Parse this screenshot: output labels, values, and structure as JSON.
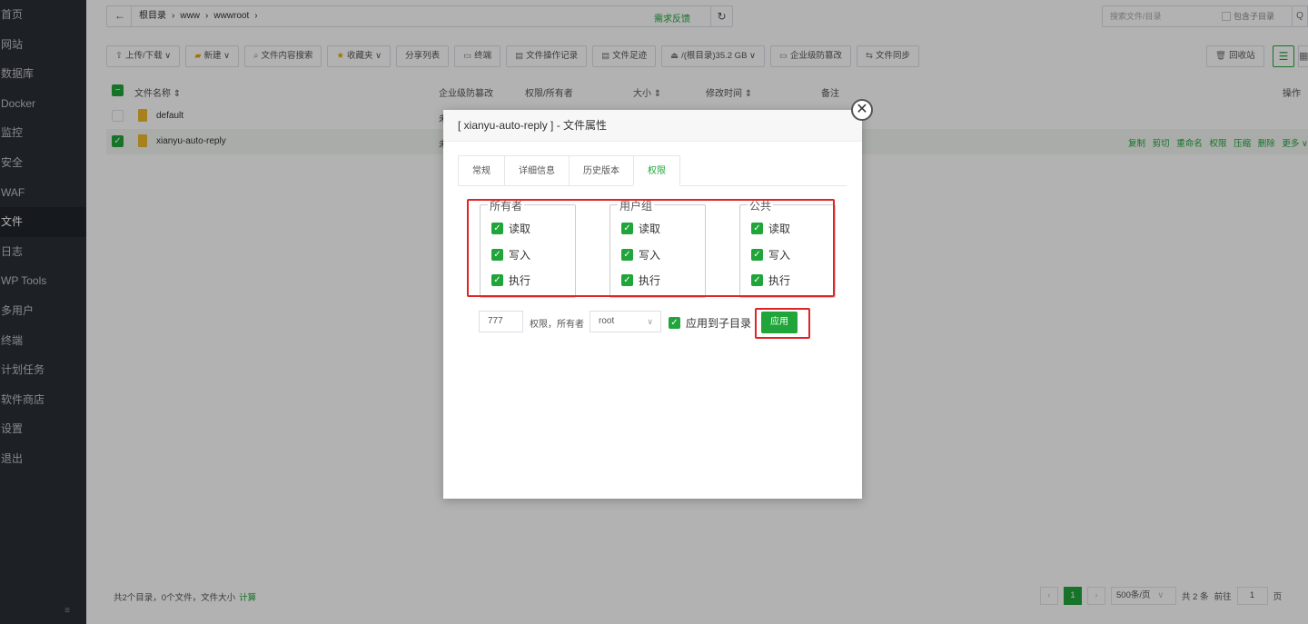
{
  "sidebar": {
    "items": [
      "首页",
      "网站",
      "数据库",
      "Docker",
      "监控",
      "安全",
      "WAF",
      "文件",
      "日志",
      "WP Tools",
      "多用户",
      "终端",
      "计划任务",
      "软件商店",
      "设置",
      "退出"
    ],
    "active_index": 7,
    "footer": "≡"
  },
  "pathbar": {
    "back": "←",
    "crumbs": [
      "根目录",
      "›",
      "www",
      "›",
      "wwwroot",
      "›"
    ],
    "refresh": "↻"
  },
  "feedback": "需求反馈",
  "search": {
    "placeholder": "搜索文件/目录",
    "include_sub": "包含子目录",
    "button": "Q"
  },
  "toolbar": [
    {
      "icon": "⇧",
      "label": "上传/下载 ∨"
    },
    {
      "icon": "▰",
      "label": "新建 ∨",
      "yellow": true
    },
    {
      "icon": "⌕",
      "label": "文件内容搜索"
    },
    {
      "icon": "★",
      "label": "收藏夹 ∨",
      "yellow": true
    },
    {
      "icon": "",
      "label": "分享列表"
    },
    {
      "icon": "▭",
      "label": "终端"
    },
    {
      "icon": "▤",
      "label": "文件操作记录"
    },
    {
      "icon": "▤",
      "label": "文件足迹"
    },
    {
      "icon": "⏏",
      "label": "/(根目录)35.2 GB ∨"
    },
    {
      "icon": "▭",
      "label": "企业级防篡改"
    },
    {
      "icon": "⇆",
      "label": "文件同步"
    }
  ],
  "recycle": "回收站",
  "view_list_icon": "☰",
  "view_grid_icon": "▦",
  "table": {
    "headers": {
      "name": "文件名称 ⇕",
      "tamper": "企业级防篡改",
      "perm": "权限/所有者",
      "size": "大小 ⇕",
      "mtime": "修改时间 ⇕",
      "note": "备注",
      "ops": "操作"
    },
    "rows": [
      {
        "name": "default",
        "tamper": "未",
        "selected": false
      },
      {
        "name": "xianyu-auto-reply",
        "tamper": "未",
        "selected": true
      }
    ],
    "row_ops": [
      "复制",
      "剪切",
      "重命名",
      "权限",
      "压缩",
      "删除",
      "更多 ∨"
    ]
  },
  "footer": {
    "summary": "共2个目录，0个文件，文件大小",
    "calc": "计算"
  },
  "pager": {
    "prev": "‹",
    "current": "1",
    "next": "›",
    "page_size": "500条/页",
    "arrow": "∨",
    "total": "共 2 条",
    "goto": "前往",
    "page_input": "1",
    "page_suffix": "页"
  },
  "dialog": {
    "title": "[ xianyu-auto-reply ] - 文件属性",
    "close": "✕",
    "tabs": [
      "常规",
      "详细信息",
      "历史版本",
      "权限"
    ],
    "active_tab": 3,
    "groups": [
      {
        "legend": "所有者",
        "items": [
          "读取",
          "写入",
          "执行"
        ]
      },
      {
        "legend": "用户组",
        "items": [
          "读取",
          "写入",
          "执行"
        ]
      },
      {
        "legend": "公共",
        "items": [
          "读取",
          "写入",
          "执行"
        ]
      }
    ],
    "checkmark": "✓",
    "perm_value": "777",
    "perm_owner_label": "权限，所有者",
    "owner": "root",
    "owner_arrow": "∨",
    "apply_sub": "应用到子目录",
    "apply_button": "应用"
  },
  "colors": {
    "accent": "#20a53a",
    "highlight": "#e02424",
    "sidebar_bg": "#2a2e35"
  }
}
